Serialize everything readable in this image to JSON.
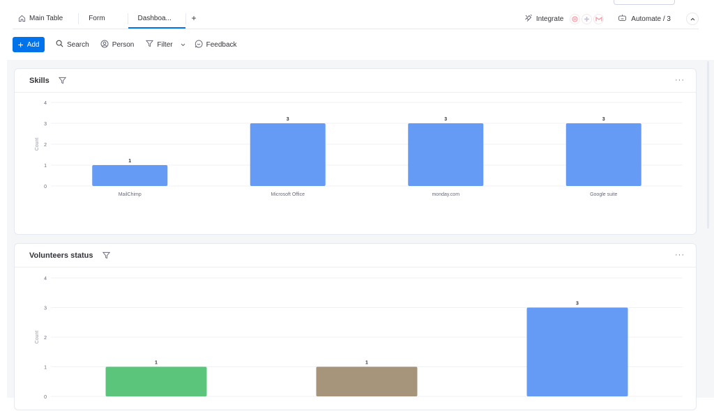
{
  "tabs": [
    {
      "label": "Main Table",
      "icon": "home-icon"
    },
    {
      "label": "Form"
    },
    {
      "label": "Dashboa...",
      "active": true
    },
    {
      "label": "+"
    }
  ],
  "top_right": {
    "integrate_label": "Integrate",
    "automate_label": "Automate / 3",
    "apps": [
      "lifebuoy-app-icon",
      "slack-icon",
      "gmail-icon"
    ]
  },
  "toolbar": {
    "add_label": "Add",
    "search_label": "Search",
    "person_label": "Person",
    "filter_label": "Filter",
    "feedback_label": "Feedback"
  },
  "colors": {
    "accent": "#0073ea",
    "bar_blue": "#659bf4",
    "bar_green": "#5bc57b",
    "bar_brown": "#a6957a"
  },
  "chart_data": [
    {
      "type": "bar",
      "title": "Skills",
      "categories": [
        "MailChimp",
        "Microsoft Office",
        "monday.com",
        "Google suite"
      ],
      "values": [
        1,
        3,
        3,
        3
      ],
      "colors": [
        "#659bf4",
        "#659bf4",
        "#659bf4",
        "#659bf4"
      ],
      "xlabel": "",
      "ylabel": "Count",
      "ylim": [
        0,
        4
      ],
      "yticks": [
        0,
        1,
        2,
        3,
        4
      ],
      "grid": true,
      "more_label": "···"
    },
    {
      "type": "bar",
      "title": "Volunteers status",
      "categories": [
        "",
        "",
        ""
      ],
      "values": [
        1,
        1,
        3
      ],
      "colors": [
        "#5bc57b",
        "#a6957a",
        "#659bf4"
      ],
      "xlabel": "",
      "ylabel": "Count",
      "ylim": [
        0,
        4
      ],
      "yticks": [
        0,
        1,
        2,
        3,
        4
      ],
      "grid": true,
      "more_label": "···"
    }
  ]
}
